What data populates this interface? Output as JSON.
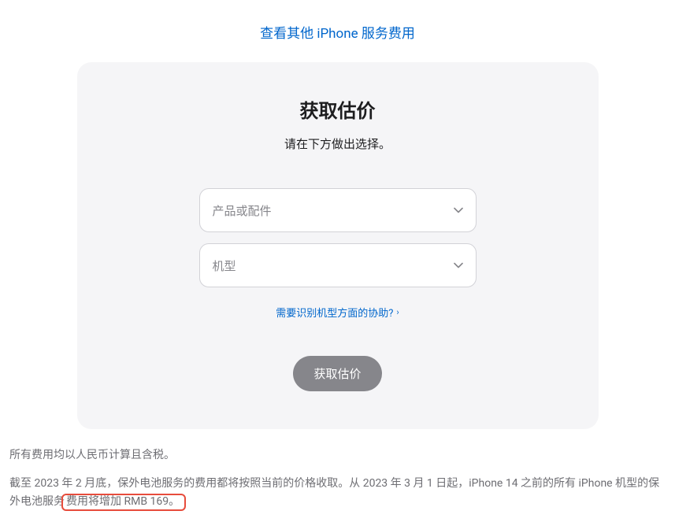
{
  "topLink": {
    "label": "查看其他 iPhone 服务费用"
  },
  "card": {
    "title": "获取估价",
    "subtitle": "请在下方做出选择。",
    "select1": {
      "placeholder": "产品或配件"
    },
    "select2": {
      "placeholder": "机型"
    },
    "helpLink": {
      "label": "需要识别机型方面的协助?"
    },
    "button": {
      "label": "获取估价"
    }
  },
  "footer": {
    "line1": "所有费用均以人民币计算且含税。",
    "line2_part1": "截至 2023 年 2 月底，保外电池服务的费用都将按照当前的价格收取。从 2023 年 3 月 1 日起，iPhone 14 之前的所有 iPhone 机型的保外电池服务",
    "line2_highlight": "费用将增加 RMB 169。"
  }
}
